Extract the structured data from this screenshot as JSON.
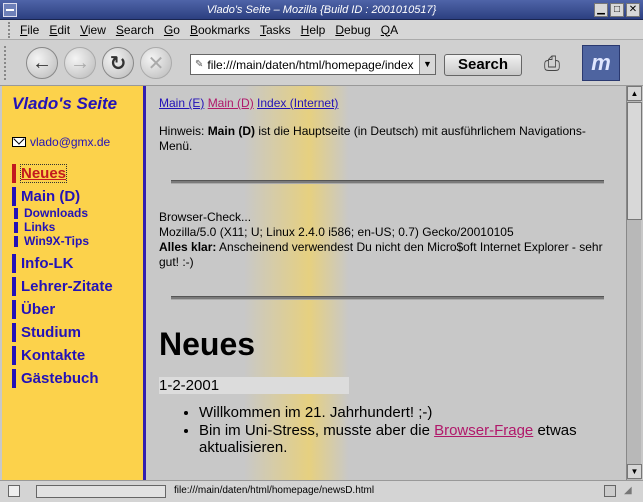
{
  "window": {
    "title": "Vlado's Seite – Mozilla {Build ID : 2001010517}"
  },
  "menubar": {
    "items": [
      {
        "underline": "F",
        "rest": "ile"
      },
      {
        "underline": "E",
        "rest": "dit"
      },
      {
        "underline": "V",
        "rest": "iew"
      },
      {
        "underline": "S",
        "rest": "earch"
      },
      {
        "underline": "G",
        "rest": "o"
      },
      {
        "underline": "B",
        "rest": "ookmarks"
      },
      {
        "underline": "T",
        "rest": "asks"
      },
      {
        "underline": "H",
        "rest": "elp"
      },
      {
        "underline": "D",
        "rest": "ebug"
      },
      {
        "underline": "Q",
        "rest": "A"
      }
    ]
  },
  "navbar": {
    "url": "file:///main/daten/html/homepage/index",
    "search_label": "Search"
  },
  "sidebar": {
    "title": "Vlado's Seite",
    "email": "vlado@gmx.de",
    "items": [
      {
        "label": "Neues",
        "active": true,
        "sub": false
      },
      {
        "label": "Main (D)",
        "active": false,
        "sub": false
      },
      {
        "label": "Downloads",
        "active": false,
        "sub": true
      },
      {
        "label": "Links",
        "active": false,
        "sub": true
      },
      {
        "label": "Win9X-Tips",
        "active": false,
        "sub": true
      },
      {
        "label": "Info-LK",
        "active": false,
        "sub": false
      },
      {
        "label": "Lehrer-Zitate",
        "active": false,
        "sub": false
      },
      {
        "label": "Über",
        "active": false,
        "sub": false
      },
      {
        "label": "Studium",
        "active": false,
        "sub": false
      },
      {
        "label": "Kontakte",
        "active": false,
        "sub": false
      },
      {
        "label": "Gästebuch",
        "active": false,
        "sub": false
      }
    ]
  },
  "main": {
    "links": {
      "main_e": "Main (E)",
      "main_d": "Main (D)",
      "index": "Index (Internet)"
    },
    "note": {
      "prefix": "Hinweis: ",
      "bold": "Main (D)",
      "rest": " ist die Hauptseite (in Deutsch) mit ausführlichem Navigations-Menü."
    },
    "browser_check": {
      "line1": "Browser-Check...",
      "line2": "Mozilla/5.0 (X11; U; Linux 2.4.0 i586; en-US; 0.7) Gecko/20010105",
      "bold": "Alles klar:",
      "rest": " Anscheinend verwendest Du nicht den Micro$oft Internet Explorer - sehr gut! :-)"
    },
    "headline": "Neues",
    "date": "1-2-2001",
    "news": {
      "item1": "Willkommen im 21. Jahrhundert! ;-)",
      "item2_pre": "Bin im Uni-Stress, musste aber die ",
      "item2_link": "Browser-Frage",
      "item2_post": " etwas aktualisieren."
    }
  },
  "statusbar": {
    "text": "file:///main/daten/html/homepage/newsD.html"
  }
}
